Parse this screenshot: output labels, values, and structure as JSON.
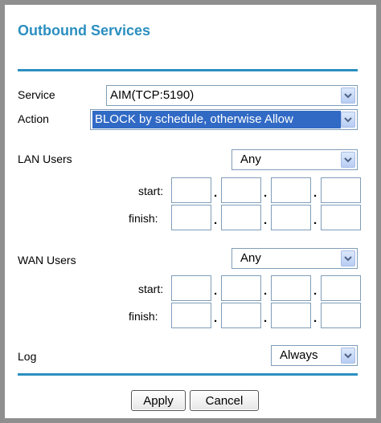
{
  "page": {
    "title": "Outbound Services"
  },
  "form": {
    "service": {
      "label": "Service",
      "value": "AIM(TCP:5190)"
    },
    "action": {
      "label": "Action",
      "value": "BLOCK by schedule, otherwise Allow"
    },
    "lan_users": {
      "label": "LAN Users",
      "value": "Any",
      "start_label": "start:",
      "finish_label": "finish:",
      "start_octets": [
        "",
        "",
        "",
        ""
      ],
      "finish_octets": [
        "",
        "",
        "",
        ""
      ]
    },
    "wan_users": {
      "label": "WAN Users",
      "value": "Any",
      "start_label": "start:",
      "finish_label": "finish:",
      "start_octets": [
        "",
        "",
        "",
        ""
      ],
      "finish_octets": [
        "",
        "",
        "",
        ""
      ]
    },
    "log": {
      "label": "Log",
      "value": "Always"
    }
  },
  "buttons": {
    "apply": "Apply",
    "cancel": "Cancel"
  },
  "colors": {
    "accent": "#2b8fc0",
    "frame": "#8f8f8f",
    "selection": "#316ac5"
  },
  "icons": {
    "dropdown": "chevron-down-icon"
  }
}
